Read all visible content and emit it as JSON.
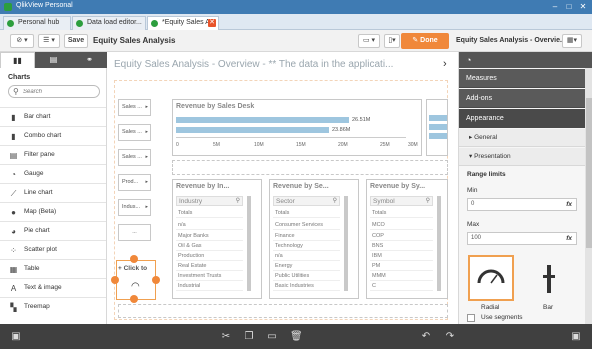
{
  "window": {
    "title": "QlikView Personal"
  },
  "tabs": [
    {
      "label": "Personal hub"
    },
    {
      "label": "Data load editor..."
    },
    {
      "label": "*Equity Sales A..."
    }
  ],
  "toolbar": {
    "save_label": "Save",
    "app_title": "Equity Sales Analysis",
    "done_label": "Done",
    "sheet_name": "Equity Sales Analysis - Overvie..."
  },
  "left_panel": {
    "heading": "Charts",
    "search_placeholder": "Search",
    "items": [
      {
        "label": "Bar chart",
        "icon": "bar-chart-icon"
      },
      {
        "label": "Combo chart",
        "icon": "combo-chart-icon"
      },
      {
        "label": "Filter pane",
        "icon": "filter-pane-icon"
      },
      {
        "label": "Gauge",
        "icon": "gauge-icon"
      },
      {
        "label": "Line chart",
        "icon": "line-chart-icon"
      },
      {
        "label": "Map (Beta)",
        "icon": "map-icon"
      },
      {
        "label": "Pie chart",
        "icon": "pie-chart-icon"
      },
      {
        "label": "Scatter plot",
        "icon": "scatter-plot-icon"
      },
      {
        "label": "Table",
        "icon": "table-icon"
      },
      {
        "label": "Text & image",
        "icon": "text-image-icon"
      },
      {
        "label": "Treemap",
        "icon": "treemap-icon"
      }
    ]
  },
  "canvas": {
    "sheet_title": "Equity Sales Analysis - Overview - ** The data in the applicati...",
    "listboxes": [
      "Sales ...",
      "Sales ...",
      "Sales ...",
      "Prod...",
      "Indus...",
      "..."
    ],
    "click_to_label": "Click to",
    "bar_panel": {
      "title": "Revenue by Sales Desk",
      "bars": [
        {
          "label": "26.51M",
          "value": 26.51
        },
        {
          "label": "23.86M",
          "value": 23.86
        }
      ],
      "axis_ticks": [
        "0",
        "5M",
        "10M",
        "15M",
        "20M",
        "25M",
        "30M"
      ]
    },
    "filter_panels": [
      {
        "title": "Revenue by In...",
        "field": "Industry",
        "rows": [
          "Totals",
          "n/a",
          "Major Banks",
          "Oil & Gas",
          "Production",
          "Real Estate",
          "Investment Trusts",
          "Industrial"
        ]
      },
      {
        "title": "Revenue by Se...",
        "field": "Sector",
        "rows": [
          "Totals",
          "Consumer Services",
          "Finance",
          "Technology",
          "n/a",
          "Energy",
          "Public Utilities",
          "Basic Industries"
        ]
      },
      {
        "title": "Revenue by Sy...",
        "field": "Symbol",
        "rows": [
          "Totals",
          "MCO",
          "COP",
          "BNS",
          "IBM",
          "PM",
          "MMM",
          "C"
        ]
      }
    ]
  },
  "right_panel": {
    "sections": [
      "Measures",
      "Add-ons",
      "Appearance"
    ],
    "subsections": [
      "General",
      "Presentation"
    ],
    "range_limits_label": "Range limits",
    "min_label": "Min",
    "min_value": "0",
    "max_label": "Max",
    "max_value": "100",
    "fx_label": "fx",
    "gauge_types": [
      "Radial",
      "Bar"
    ],
    "use_segments_label": "Use segments"
  },
  "colors": {
    "accent": "#f0883a",
    "title_bar": "#3f7bb3",
    "bar_fill": "#9ec6df",
    "dark_panel": "#5a5a5a"
  }
}
